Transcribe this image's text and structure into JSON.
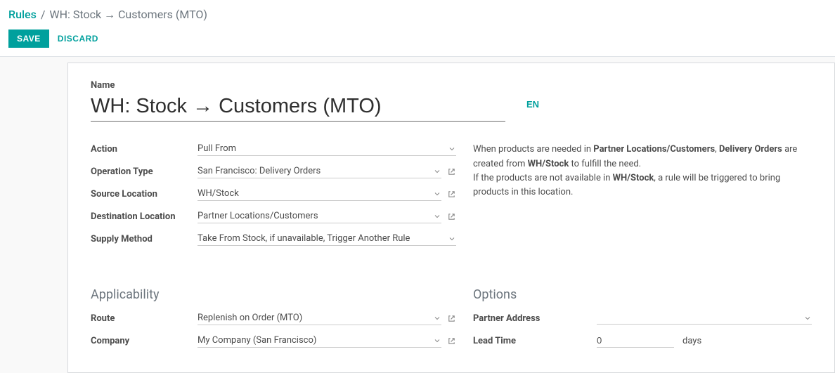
{
  "breadcrumb": {
    "root": "Rules",
    "sep": "/",
    "current": "WH: Stock → Customers (MTO)"
  },
  "actions": {
    "save": "SAVE",
    "discard": "DISCARD"
  },
  "form": {
    "name_label": "Name",
    "name_value": "WH: Stock → Customers (MTO)",
    "lang_button": "EN",
    "fields": {
      "action": {
        "label": "Action",
        "value": "Pull From"
      },
      "operation_type": {
        "label": "Operation Type",
        "value": "San Francisco: Delivery Orders"
      },
      "source_location": {
        "label": "Source Location",
        "value": "WH/Stock"
      },
      "destination_location": {
        "label": "Destination Location",
        "value": "Partner Locations/Customers"
      },
      "supply_method": {
        "label": "Supply Method",
        "value": "Take From Stock, if unavailable, Trigger Another Rule"
      }
    },
    "description": {
      "t1": "When products are needed in ",
      "b1": "Partner Locations/Customers",
      "t2": ", ",
      "b2": "Delivery Orders",
      "t3": " are created from ",
      "b3": "WH/Stock",
      "t4": " to fulfill the need.",
      "t5": "If the products are not available in ",
      "b4": "WH/Stock",
      "t6": ", a rule will be triggered to bring products in this location."
    },
    "applicability": {
      "title": "Applicability",
      "route": {
        "label": "Route",
        "value": "Replenish on Order (MTO)"
      },
      "company": {
        "label": "Company",
        "value": "My Company (San Francisco)"
      }
    },
    "options": {
      "title": "Options",
      "partner_address": {
        "label": "Partner Address",
        "value": ""
      },
      "lead_time": {
        "label": "Lead Time",
        "value": "0",
        "suffix": "days"
      }
    }
  }
}
